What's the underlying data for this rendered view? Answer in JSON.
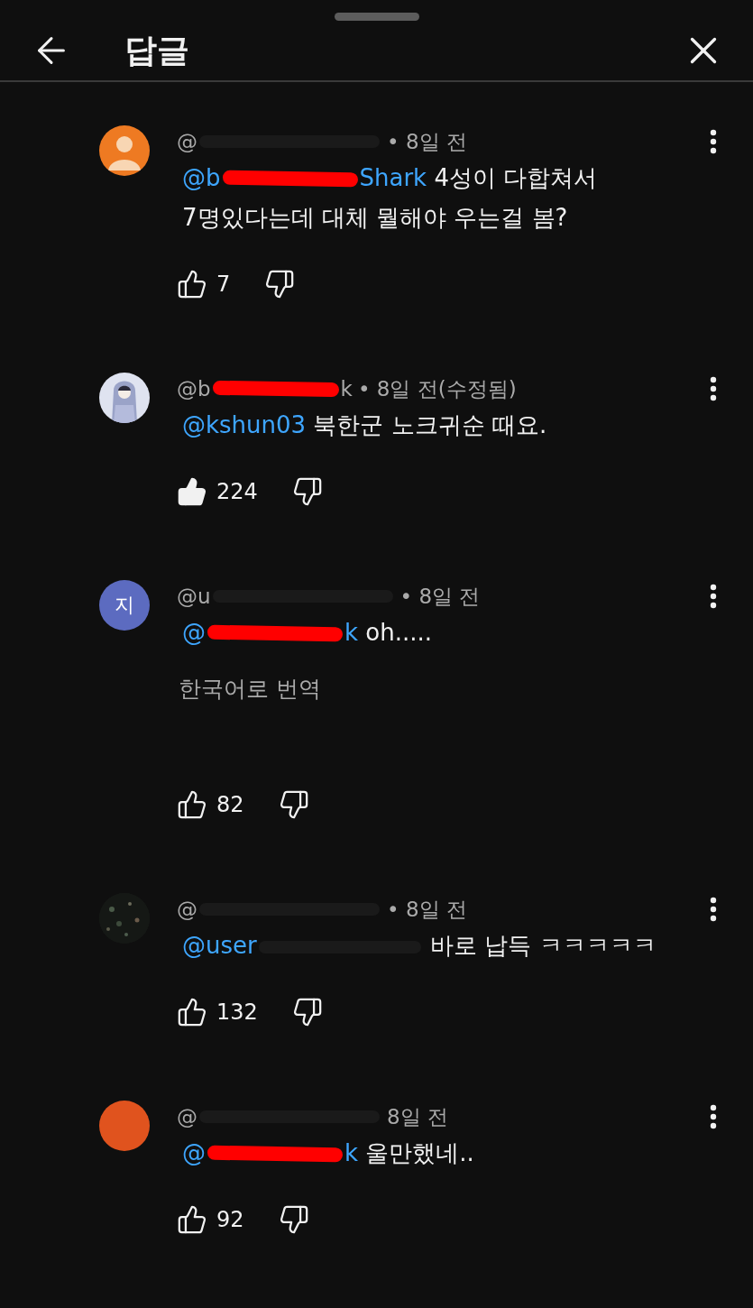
{
  "header": {
    "title": "답글"
  },
  "comments": [
    {
      "avatar": {
        "kind": "default",
        "color": "#ee7a22"
      },
      "author": {
        "prefix": "@",
        "blurred": true
      },
      "time": "• 8일 전",
      "mention": {
        "prefix": "@b",
        "scribbled": true,
        "suffix": "Shark"
      },
      "body": "4성이 다합쳐서 7명있다는데 대체 뭘해야 우는걸 봄?",
      "likes": "7",
      "liked": false
    },
    {
      "avatar": {
        "kind": "illustration",
        "color": "#dfe3f0"
      },
      "author": {
        "prefix": "@b",
        "scribbled": true,
        "suffix": "k"
      },
      "time": "• 8일 전(수정됨)",
      "mention": {
        "prefix": "@kshun03"
      },
      "body": "북한군 노크귀순 때요.",
      "likes": "224",
      "liked": true
    },
    {
      "avatar": {
        "kind": "letter",
        "color": "#5c6bc0",
        "letter": "지"
      },
      "author": {
        "prefix": "@u",
        "blurred": true
      },
      "time": "• 8일 전",
      "mention": {
        "prefix": "@",
        "scribbled": true,
        "suffix": "k"
      },
      "body": "oh.....",
      "translate": "한국어로 번역",
      "likes": "82",
      "liked": false
    },
    {
      "author": {
        "prefix": "@",
        "blurred": true
      },
      "time": "• 8일 전",
      "mention": {
        "prefix": "@user",
        "blurred": true
      },
      "body": "바로 납득 ㅋㅋㅋㅋㅋ",
      "likes": "132",
      "liked": false
    },
    {
      "avatar": {
        "kind": "plain",
        "color": "#e0531e"
      },
      "author": {
        "prefix": "@",
        "blurred": true
      },
      "time": "8일 전",
      "mention": {
        "prefix": "@",
        "scribbled": true,
        "suffix": "k"
      },
      "body": "울만했네..",
      "likes": "92",
      "liked": false
    }
  ]
}
